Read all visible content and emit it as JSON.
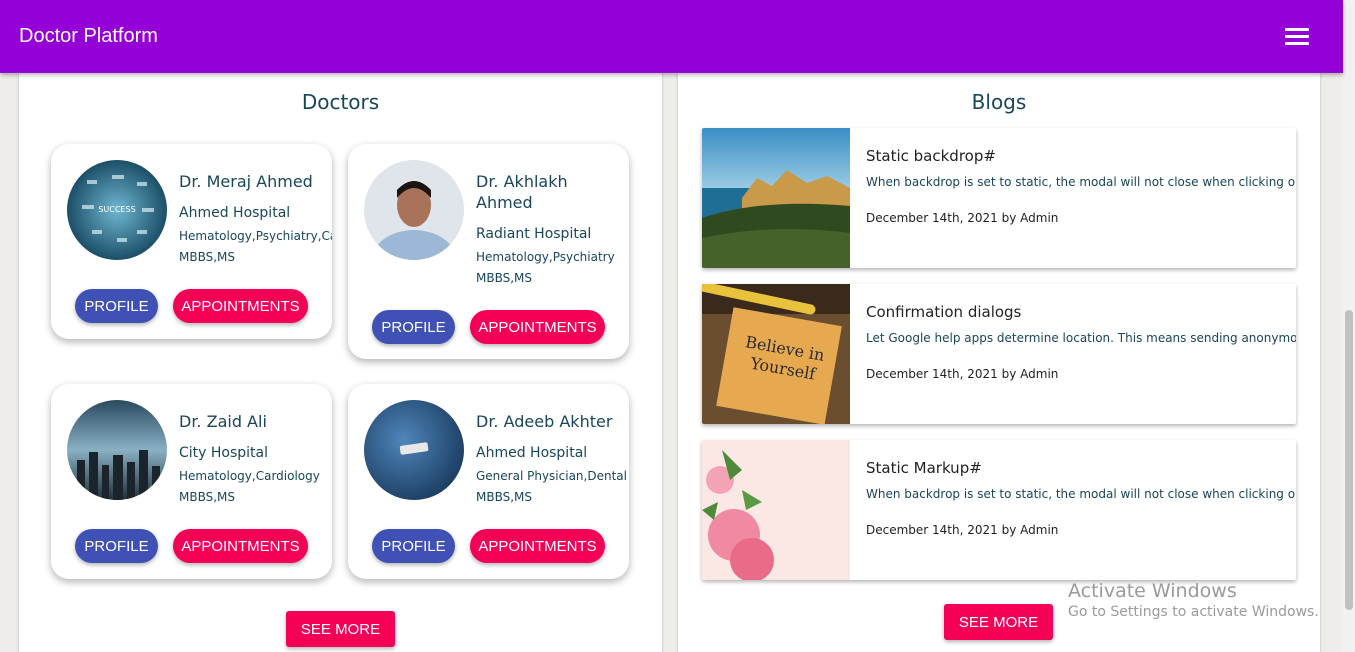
{
  "app": {
    "title": "Doctor Platform",
    "menu_icon": "hamburger-menu-icon"
  },
  "doctors_section": {
    "heading": "Doctors",
    "profile_label": "PROFILE",
    "appointments_label": "APPOINTMENTS",
    "see_more_label": "SEE MORE",
    "doctors": [
      {
        "name": "Dr. Meraj Ahmed",
        "hospital": "Ahmed Hospital",
        "specialties": "Hematology,Psychiatry,Cardiology",
        "degrees": "MBBS,MS"
      },
      {
        "name": "Dr. Akhlakh Ahmed",
        "hospital": "Radiant Hospital",
        "specialties": "Hematology,Psychiatry",
        "degrees": "MBBS,MS"
      },
      {
        "name": "Dr. Zaid Ali",
        "hospital": "City Hospital",
        "specialties": "Hematology,Cardiology",
        "degrees": "MBBS,MS"
      },
      {
        "name": "Dr. Adeeb Akhter",
        "hospital": "Ahmed Hospital",
        "specialties": "General Physician,Dental",
        "degrees": "MBBS,MS"
      }
    ]
  },
  "blogs_section": {
    "heading": "Blogs",
    "see_more_label": "SEE MORE",
    "posts": [
      {
        "title": "Static backdrop#",
        "excerpt": "When backdrop is set to static, the modal will not close when clicking outside it. Click the button below to try it.",
        "meta": "December 14th, 2021 by Admin",
        "image_text": ""
      },
      {
        "title": "Confirmation dialogs",
        "excerpt": "Let Google help apps determine location. This means sending anonymous location data to Google.",
        "meta": "December 14th, 2021 by Admin",
        "image_text": "Believe in Yourself"
      },
      {
        "title": "Static Markup#",
        "excerpt": "When backdrop is set to static, the modal will not close when clicking outside it. Click the button below to try it.",
        "meta": "December 14th, 2021 by Admin",
        "image_text": ""
      }
    ]
  },
  "watermark": {
    "line1": "Activate Windows",
    "line2": "Go to Settings to activate Windows."
  },
  "colors": {
    "appbar": "#9500d6",
    "profile_button": "#3f51b5",
    "accent": "#f50057",
    "heading": "#18465a"
  }
}
